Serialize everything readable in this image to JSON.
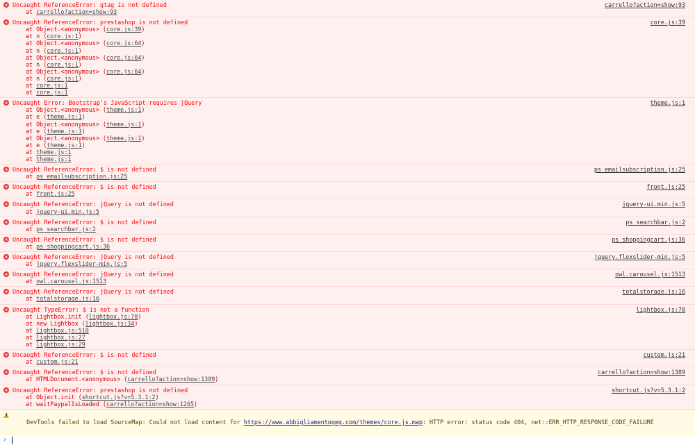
{
  "console": {
    "messages": [
      {
        "text": "Uncaught ReferenceError: gtag is not defined",
        "source": "carrello?action=show:93",
        "frames": [
          {
            "pre": "at ",
            "loc": "carrello?action=show:93",
            "post": ""
          }
        ]
      },
      {
        "text": "Uncaught ReferenceError: prestashop is not defined",
        "source": "core.js:39",
        "frames": [
          {
            "pre": "at Object.<anonymous> (",
            "loc": "core.js:39",
            "post": ")"
          },
          {
            "pre": "at n (",
            "loc": "core.js:1",
            "post": ")"
          },
          {
            "pre": "at Object.<anonymous> (",
            "loc": "core.js:64",
            "post": ")"
          },
          {
            "pre": "at n (",
            "loc": "core.js:1",
            "post": ")"
          },
          {
            "pre": "at Object.<anonymous> (",
            "loc": "core.js:64",
            "post": ")"
          },
          {
            "pre": "at n (",
            "loc": "core.js:1",
            "post": ")"
          },
          {
            "pre": "at Object.<anonymous> (",
            "loc": "core.js:64",
            "post": ")"
          },
          {
            "pre": "at n (",
            "loc": "core.js:1",
            "post": ")"
          },
          {
            "pre": "at ",
            "loc": "core.js:1",
            "post": ""
          },
          {
            "pre": "at ",
            "loc": "core.js:1",
            "post": ""
          }
        ]
      },
      {
        "text": "Uncaught Error: Bootstrap's JavaScript requires jQuery",
        "source": "theme.js:1",
        "frames": [
          {
            "pre": "at Object.<anonymous> (",
            "loc": "theme.js:1",
            "post": ")"
          },
          {
            "pre": "at e (",
            "loc": "theme.js:1",
            "post": ")"
          },
          {
            "pre": "at Object.<anonymous> (",
            "loc": "theme.js:1",
            "post": ")"
          },
          {
            "pre": "at e (",
            "loc": "theme.js:1",
            "post": ")"
          },
          {
            "pre": "at Object.<anonymous> (",
            "loc": "theme.js:1",
            "post": ")"
          },
          {
            "pre": "at e (",
            "loc": "theme.js:1",
            "post": ")"
          },
          {
            "pre": "at ",
            "loc": "theme.js:1",
            "post": ""
          },
          {
            "pre": "at ",
            "loc": "theme.js:1",
            "post": ""
          }
        ]
      },
      {
        "text": "Uncaught ReferenceError: $ is not defined",
        "source": "ps_emailsubscription.js:25",
        "frames": [
          {
            "pre": "at ",
            "loc": "ps_emailsubscription.js:25",
            "post": ""
          }
        ]
      },
      {
        "text": "Uncaught ReferenceError: $ is not defined",
        "source": "front.js:25",
        "frames": [
          {
            "pre": "at ",
            "loc": "front.js:25",
            "post": ""
          }
        ]
      },
      {
        "text": "Uncaught ReferenceError: jQuery is not defined",
        "source": "jquery-ui.min.js:5",
        "frames": [
          {
            "pre": "at ",
            "loc": "jquery-ui.min.js:5",
            "post": ""
          }
        ]
      },
      {
        "text": "Uncaught ReferenceError: $ is not defined",
        "source": "ps_searchbar.js:2",
        "frames": [
          {
            "pre": "at ",
            "loc": "ps_searchbar.js:2",
            "post": ""
          }
        ]
      },
      {
        "text": "Uncaught ReferenceError: $ is not defined",
        "source": "ps_shoppingcart.js:36",
        "frames": [
          {
            "pre": "at ",
            "loc": "ps_shoppingcart.js:36",
            "post": ""
          }
        ]
      },
      {
        "text": "Uncaught ReferenceError: jQuery is not defined",
        "source": "jquery.flexslider-min.js:5",
        "frames": [
          {
            "pre": "at ",
            "loc": "jquery.flexslider-min.js:5",
            "post": ""
          }
        ]
      },
      {
        "text": "Uncaught ReferenceError: jQuery is not defined",
        "source": "owl.carousel.js:1513",
        "frames": [
          {
            "pre": "at ",
            "loc": "owl.carousel.js:1513",
            "post": ""
          }
        ]
      },
      {
        "text": "Uncaught ReferenceError: jQuery is not defined",
        "source": "totalstorage.js:16",
        "frames": [
          {
            "pre": "at ",
            "loc": "totalstorage.js:16",
            "post": ""
          }
        ]
      },
      {
        "text": "Uncaught TypeError: $ is not a function",
        "source": "lightbox.js:78",
        "frames": [
          {
            "pre": "at Lightbox.init (",
            "loc": "lightbox.js:78",
            "post": ")"
          },
          {
            "pre": "at new Lightbox (",
            "loc": "lightbox.js:34",
            "post": ")"
          },
          {
            "pre": "at ",
            "loc": "lightbox.js:510",
            "post": ""
          },
          {
            "pre": "at ",
            "loc": "lightbox.js:27",
            "post": ""
          },
          {
            "pre": "at ",
            "loc": "lightbox.js:29",
            "post": ""
          }
        ]
      },
      {
        "text": "Uncaught ReferenceError: $ is not defined",
        "source": "custom.js:21",
        "frames": [
          {
            "pre": "at ",
            "loc": "custom.js:21",
            "post": ""
          }
        ]
      },
      {
        "text": "Uncaught ReferenceError: $ is not defined",
        "source": "carrello?action=show:1389",
        "frames": [
          {
            "pre": "at HTMLDocument.<anonymous> (",
            "loc": "carrello?action=show:1389",
            "post": ")"
          }
        ]
      },
      {
        "text": "Uncaught ReferenceError: prestashop is not defined",
        "source": "shortcut.js?v=5.3.1:2",
        "frames": [
          {
            "pre": "at Object.init (",
            "loc": "shortcut.js?v=5.3.1:2",
            "post": ")"
          },
          {
            "pre": "at waitPaypalIsLoaded (",
            "loc": "carrello?action=show:1265",
            "post": ")"
          }
        ]
      }
    ],
    "warning": {
      "pre": "DevTools failed to load SourceMap: Could not load content for ",
      "link": "https://www.abbigliamentogeg.com/themes/core.js.map",
      "post": ": HTTP error: status code 404, net::ERR_HTTP_RESPONSE_CODE_FAILURE"
    },
    "prompt": {
      "chevron": "›"
    },
    "icons": {
      "error": "error-circle-icon",
      "warning": "warning-triangle-icon",
      "prompt": "chevron-right-icon"
    },
    "colors": {
      "error_text": "#ff0000",
      "error_bg": "#fff0f0",
      "warning_bg": "#fffbe5",
      "prompt": "#2a72d4"
    }
  }
}
